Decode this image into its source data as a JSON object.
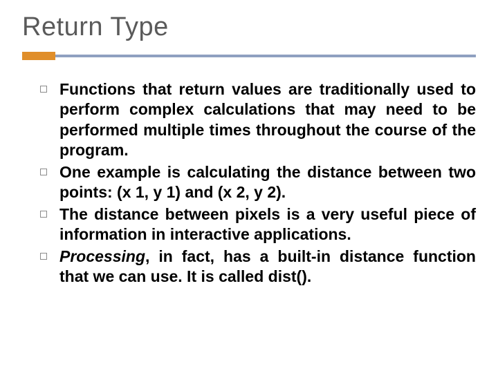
{
  "title": "Return Type",
  "bullets": [
    {
      "html": "Functions that return values are traditionally used to perform complex calculations that may need to be performed multiple times throughout the course of the program."
    },
    {
      "html": "One example is calculating the distance between two points: (x 1, y 1) and (x 2, y 2)."
    },
    {
      "html": "The distance between pixels is a very useful piece of information in interactive applications."
    },
    {
      "html": "<em>Processing</em>, in fact, has a built-in distance function that we can use. It is called dist()."
    }
  ]
}
